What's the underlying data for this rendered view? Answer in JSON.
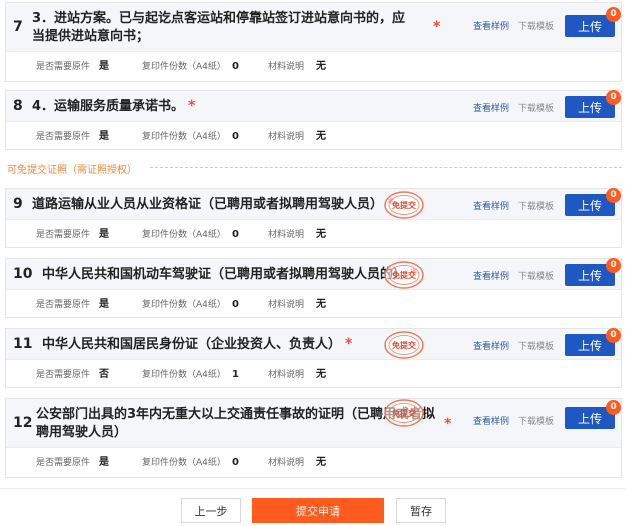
{
  "common": {
    "sample_link": "查看样例",
    "download_link": "下载模板",
    "upload_label": "上传",
    "original_label": "是否需要原件",
    "copies_label": "复印件份数（A4纸）",
    "notes_label": "材料说明",
    "star": "*",
    "stamp_text": "免提交"
  },
  "items": [
    {
      "num": "7",
      "title": "3．进站方案。已与起讫点客运站和停靠站签订进站意向书的，应当提供进站意向书；",
      "badge": "0",
      "original": "是",
      "copies": "0",
      "notes": "无"
    },
    {
      "num": "8",
      "title": "4．运输服务质量承诺书。",
      "badge": "0",
      "original": "是",
      "copies": "0",
      "notes": "无"
    },
    {
      "num": "9",
      "title": "道路运输从业人员从业资格证（已聘用或者拟聘用驾驶人员）",
      "badge": "0",
      "original": "是",
      "copies": "0",
      "notes": "无"
    },
    {
      "num": "10",
      "title": "中华人民共和国机动车驾驶证（已聘用或者拟聘用驾驶人员的）",
      "badge": "0",
      "original": "是",
      "copies": "0",
      "notes": "无"
    },
    {
      "num": "11",
      "title": "中华人民共和国居民身份证（企业投资人、负责人）",
      "badge": "0",
      "original": "否",
      "copies": "1",
      "notes": "无"
    },
    {
      "num": "12",
      "title": "公安部门出具的3年内无重大以上交通责任事故的证明（已聘用或者拟聘用驾驶人员）",
      "badge": "0",
      "original": "是",
      "copies": "0",
      "notes": "无"
    }
  ],
  "section": {
    "label": "可免提交证照（需证照授权）"
  },
  "footer": {
    "prev_label": "上一步",
    "submit_label": "提交申请",
    "save_label": "暂存"
  },
  "colors": {
    "accent": "#1f57c3",
    "orange": "#ff5b1f",
    "star": "#ff4a2e"
  }
}
